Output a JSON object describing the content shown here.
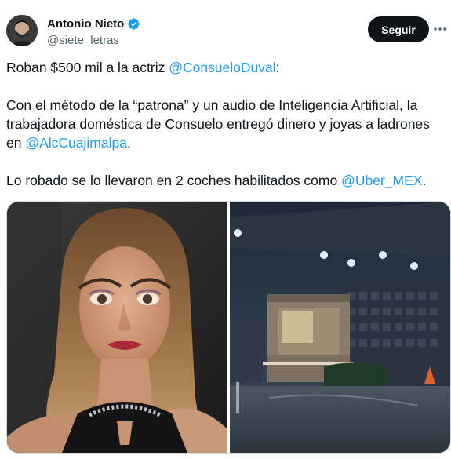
{
  "author": {
    "name": "Antonio Nieto",
    "handle": "@siete_letras",
    "verified": true,
    "avatar_icon": "profile-photo"
  },
  "actions": {
    "follow_label": "Seguir",
    "more_icon": "ellipsis-icon"
  },
  "tweet": {
    "p1": {
      "text": "Roban $500 mil a la actriz ",
      "mention": "@ConsueloDuval",
      "after": ":"
    },
    "p2": {
      "text": "Con el método de la “patrona” y un audio de Inteligencia Artificial, la trabajadora doméstica de Consuelo entregó dinero y joyas a ladrones en ",
      "mention": "@AlcCuajimalpa",
      "after": "."
    },
    "p3": {
      "text": "Lo robado se lo llevaron en 2 coches habilitados como ",
      "mention": "@Uber_MEX",
      "after": "."
    }
  },
  "media": {
    "left_image": "woman-portrait-photo",
    "right_image": "gated-entrance-night-photo"
  },
  "colors": {
    "link": "#1d9bf0",
    "text": "#0f1419",
    "secondary": "#536471",
    "verified": "#1d9bf0"
  }
}
